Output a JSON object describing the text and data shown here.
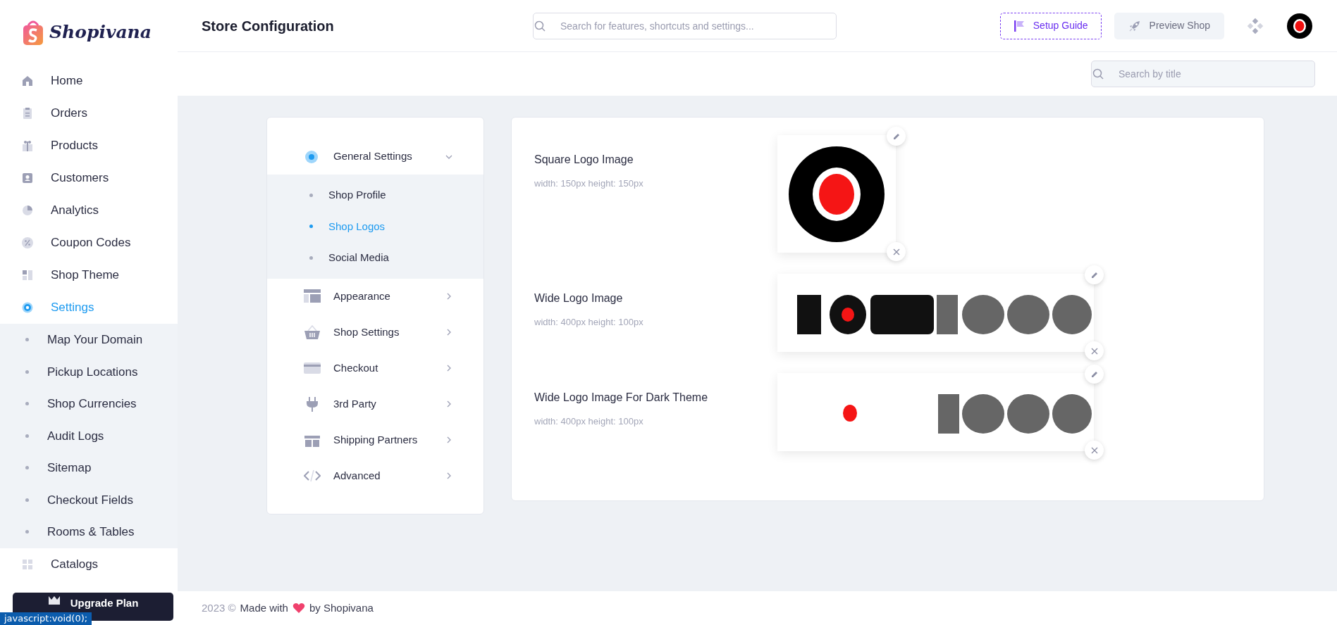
{
  "brand": {
    "name": "Shopivana"
  },
  "sidebar": {
    "items": [
      {
        "label": "Home",
        "selected": false
      },
      {
        "label": "Orders",
        "selected": false
      },
      {
        "label": "Products",
        "selected": false
      },
      {
        "label": "Customers",
        "selected": false
      },
      {
        "label": "Analytics",
        "selected": false
      },
      {
        "label": "Coupon Codes",
        "selected": false
      },
      {
        "label": "Shop Theme",
        "selected": false
      },
      {
        "label": "Settings",
        "selected": true,
        "expanded": true,
        "children": [
          {
            "label": "Map Your Domain",
            "selected": false
          },
          {
            "label": "Pickup Locations",
            "selected": false
          },
          {
            "label": "Shop Currencies",
            "selected": false
          },
          {
            "label": "Audit Logs",
            "selected": false
          },
          {
            "label": "Sitemap",
            "selected": false
          },
          {
            "label": "Checkout Fields",
            "selected": false
          },
          {
            "label": "Rooms & Tables",
            "selected": false
          }
        ]
      },
      {
        "label": "Catalogs",
        "selected": false
      }
    ],
    "upgrade_button": "Upgrade Plan"
  },
  "header": {
    "title": "Store Configuration",
    "search": {
      "placeholder": "Search for features, shortcuts and settings..."
    },
    "setup_guide": "Setup Guide",
    "preview_shop": "Preview Shop"
  },
  "subheader": {
    "search": {
      "placeholder": "Search by title"
    }
  },
  "settings_menu": [
    {
      "label": "General Settings",
      "expanded": true,
      "children": [
        {
          "label": "Shop Profile",
          "selected": false
        },
        {
          "label": "Shop Logos",
          "selected": true
        },
        {
          "label": "Social Media",
          "selected": false
        }
      ]
    },
    {
      "label": "Appearance",
      "expanded": false
    },
    {
      "label": "Shop Settings",
      "expanded": false
    },
    {
      "label": "Checkout",
      "expanded": false
    },
    {
      "label": "3rd Party",
      "expanded": false
    },
    {
      "label": "Shipping Partners",
      "expanded": false
    },
    {
      "label": "Advanced",
      "expanded": false
    }
  ],
  "logos": [
    {
      "title": "Square Logo Image",
      "size": "width: 150px height: 150px",
      "kind": "square"
    },
    {
      "title": "Wide Logo Image",
      "size": "width: 400px height: 100px",
      "kind": "wide"
    },
    {
      "title": "Wide Logo Image For Dark Theme",
      "size": "width: 400px height: 100px",
      "kind": "dark"
    }
  ],
  "footer": {
    "copyright": "2023 ©",
    "text_before": "Made with",
    "text_after": "by Shopivana"
  },
  "status_bar": "javascript:void(0);"
}
